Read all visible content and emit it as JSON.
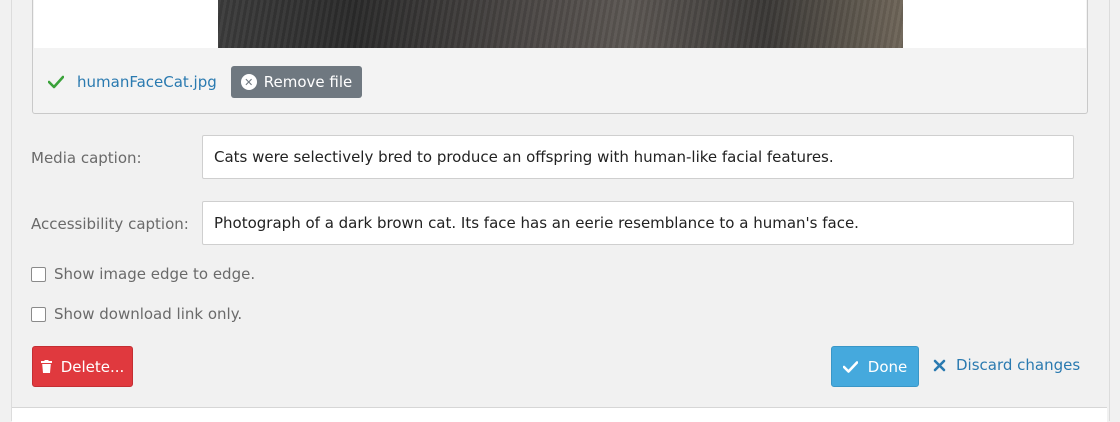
{
  "upload": {
    "file_name": "humanFaceCat.jpg",
    "remove_label": "Remove file"
  },
  "fields": {
    "media_caption_label": "Media caption:",
    "media_caption_value": "Cats were selectively bred to produce an offspring with human-like facial features.",
    "accessibility_caption_label": "Accessibility caption:",
    "accessibility_caption_value": "Photograph of a dark brown cat. Its face has an eerie resemblance to a human's face."
  },
  "options": {
    "edge_to_edge_label": "Show image edge to edge.",
    "download_only_label": "Show download link only."
  },
  "actions": {
    "delete_label": "Delete...",
    "done_label": "Done",
    "discard_label": "Discard changes"
  },
  "colors": {
    "accent": "#45a9dd",
    "danger": "#e0393e",
    "link": "#2a7ab0",
    "success": "#3aa23a"
  },
  "icons": {
    "check": "check-icon",
    "remove": "x-circle-icon",
    "delete": "trash-icon",
    "done": "check-icon",
    "discard": "close-icon"
  }
}
